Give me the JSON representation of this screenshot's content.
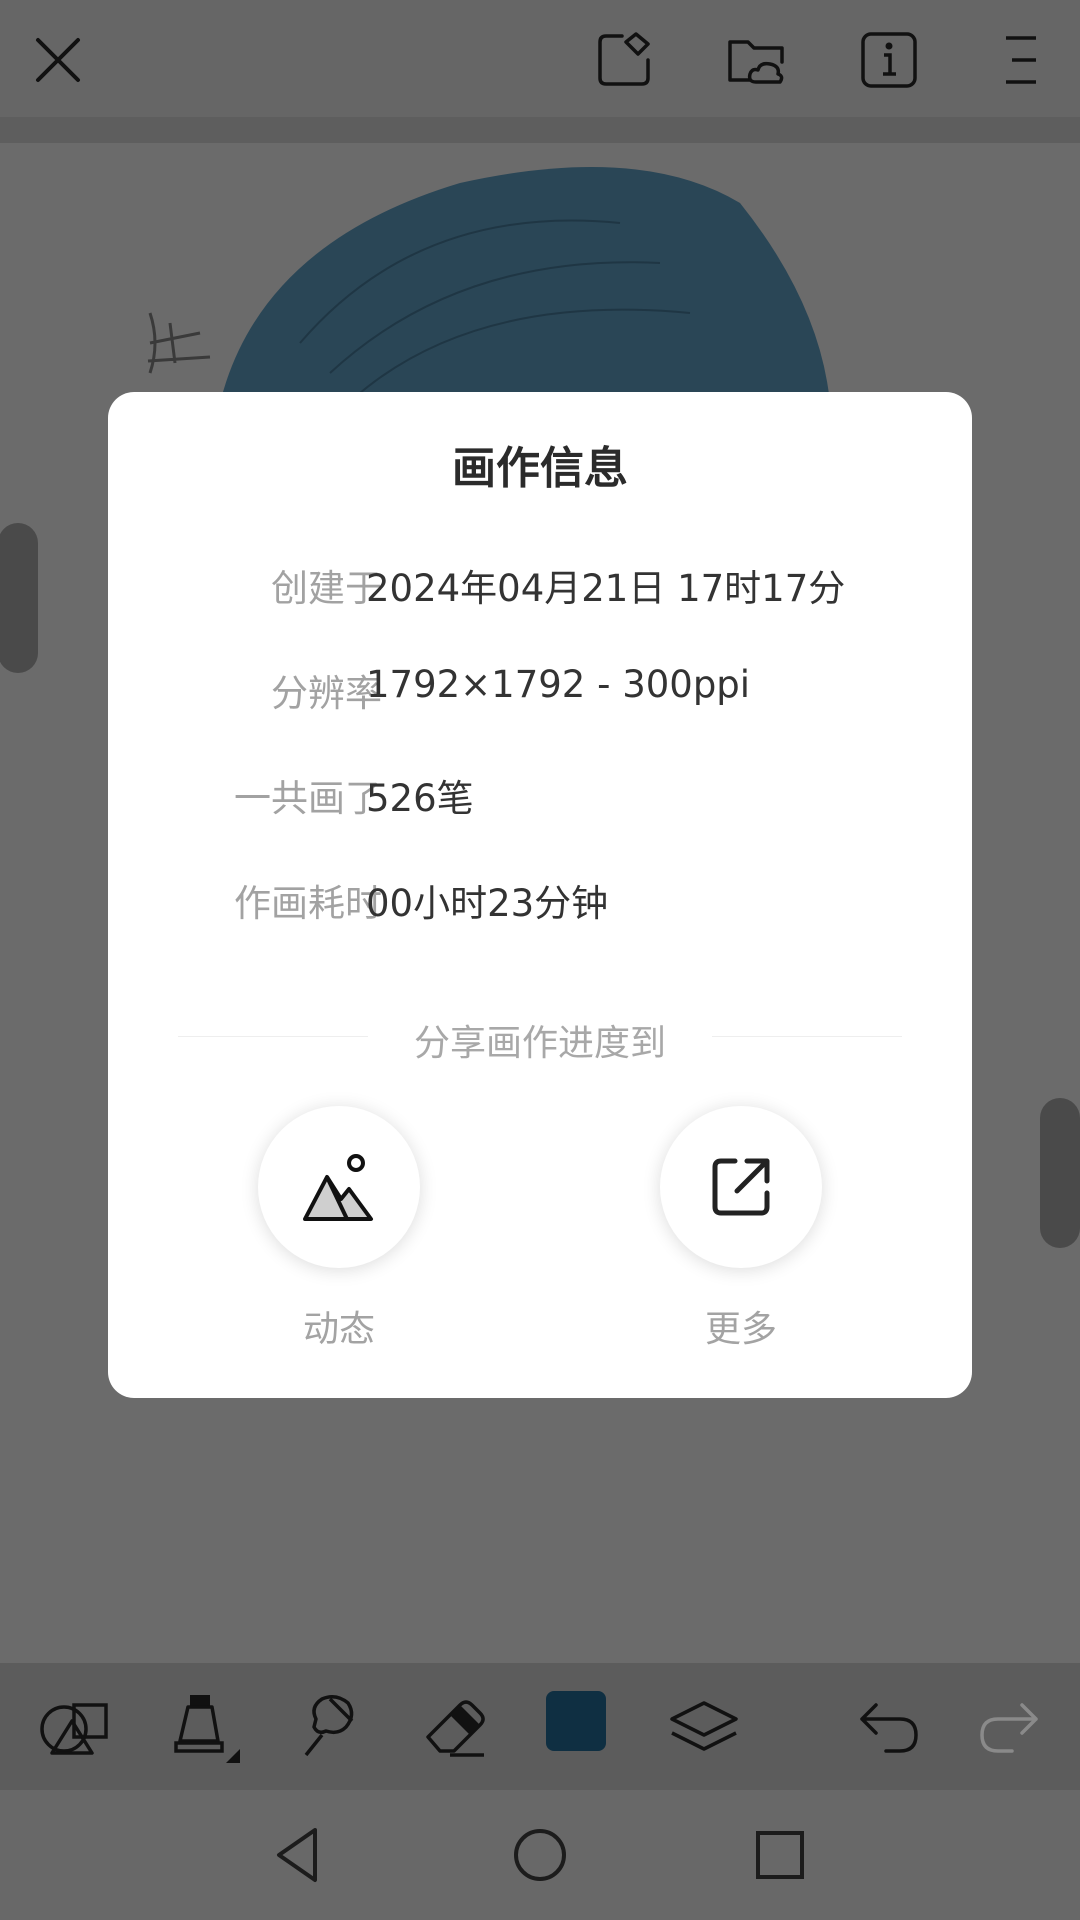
{
  "dialog": {
    "title": "画作信息",
    "rows": [
      {
        "label": "创建于",
        "value": "2024年04月21日 17时17分"
      },
      {
        "label": "分辨率",
        "value": "1792×1792 - 300ppi"
      },
      {
        "label": "一共画了",
        "value": "526笔"
      },
      {
        "label": "作画耗时",
        "value": "00小时23分钟"
      }
    ],
    "share_heading": "分享画作进度到",
    "share_options": [
      {
        "label": "动态",
        "icon": "mountain-image-icon"
      },
      {
        "label": "更多",
        "icon": "external-share-icon"
      }
    ]
  },
  "topbar": {
    "icons": [
      "close-icon",
      "canvas-crop-icon",
      "cloud-folder-icon",
      "info-icon",
      "menu-icon"
    ]
  },
  "toolbar": {
    "icons": [
      "shapes-icon",
      "brush-icon",
      "smudge-icon",
      "eraser-icon",
      "color-swatch",
      "layers-icon",
      "undo-icon",
      "redo-icon"
    ],
    "current_color": "#0f2f42"
  },
  "navbar": {
    "icons": [
      "back-icon",
      "home-icon",
      "recents-icon"
    ]
  },
  "colors": {
    "overlay": "#6a6a6a",
    "artwork_hair": "#2a4656"
  }
}
